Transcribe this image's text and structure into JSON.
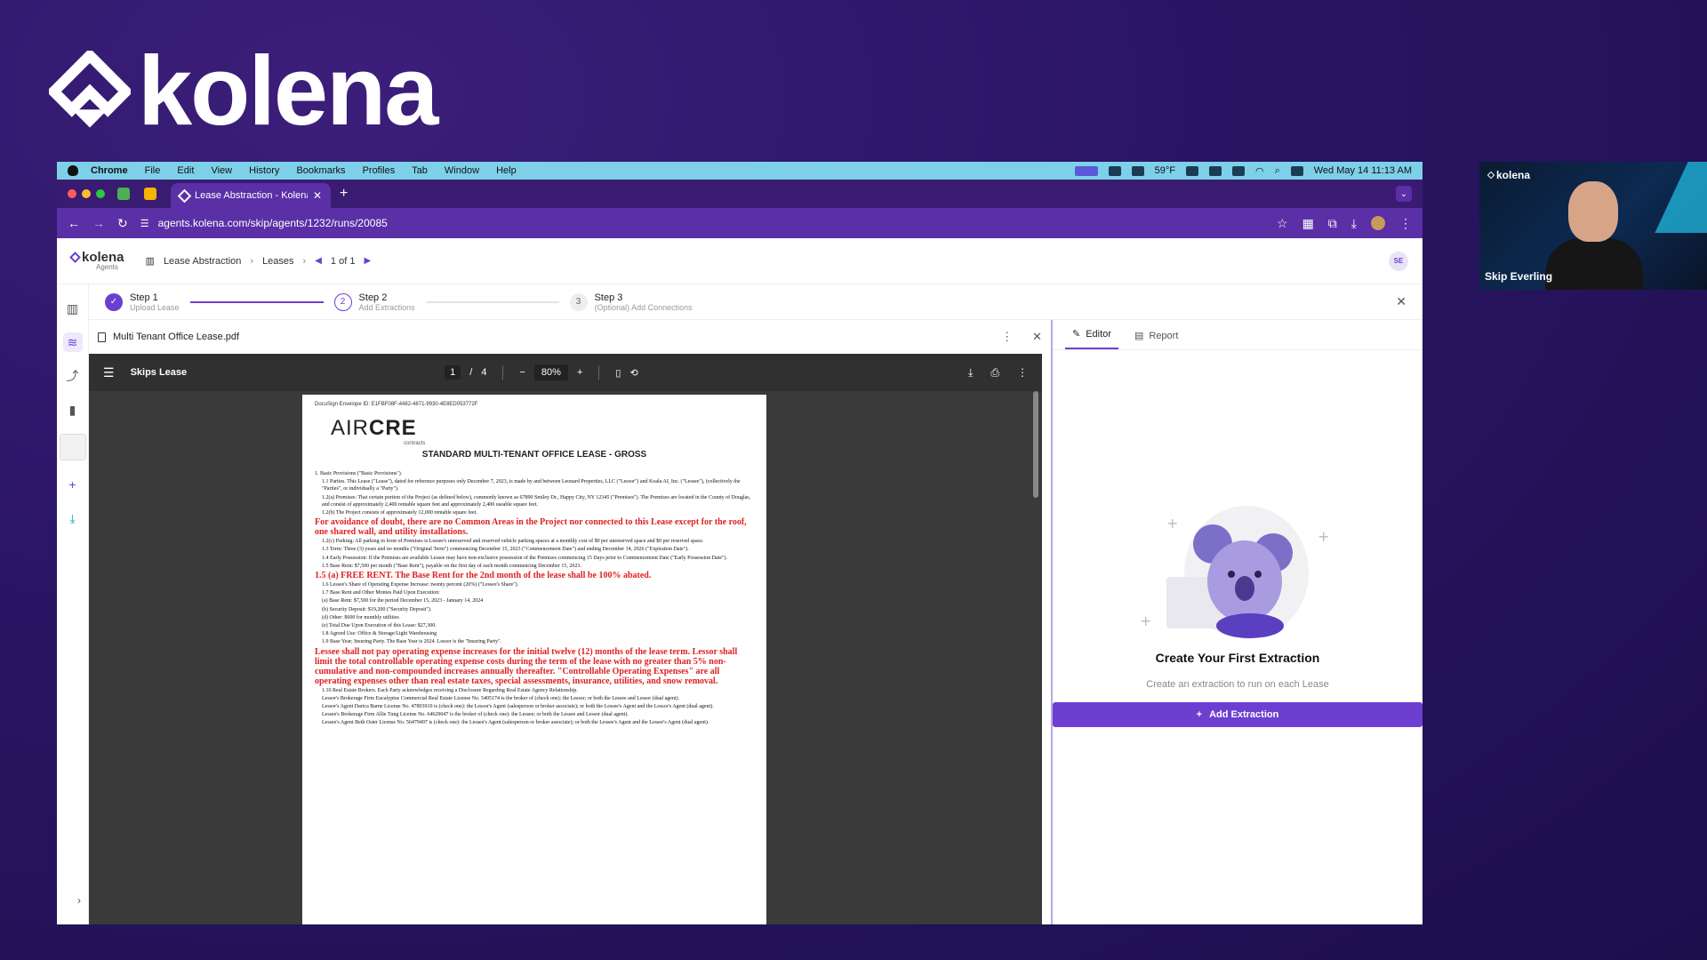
{
  "brand": {
    "wordmark": "kolena"
  },
  "mac_menu": {
    "items": [
      "Chrome",
      "File",
      "Edit",
      "View",
      "History",
      "Bookmarks",
      "Profiles",
      "Tab",
      "Window",
      "Help"
    ],
    "weather": "59°F",
    "datetime": "Wed May 14  11:13 AM"
  },
  "browser": {
    "tab_title": "Lease Abstraction - Kolena",
    "url": "agents.kolena.com/skip/agents/1232/runs/20085"
  },
  "app": {
    "logo_word": "kolena",
    "logo_sub": "Agents",
    "breadcrumb": [
      "Lease Abstraction",
      "Leases"
    ],
    "pager": "1 of 1",
    "user_initials": "SE"
  },
  "steps": [
    {
      "num": "",
      "title": "Step 1",
      "subtitle": "Upload Lease"
    },
    {
      "num": "2",
      "title": "Step 2",
      "subtitle": "Add Extractions"
    },
    {
      "num": "3",
      "title": "Step 3",
      "subtitle": "(Optional) Add Connections"
    }
  ],
  "file": {
    "name": "Multi Tenant Office Lease.pdf"
  },
  "viewer": {
    "doc_name": "Skips Lease",
    "page": "1",
    "page_total": "4",
    "zoom": "80%"
  },
  "pdf": {
    "envelope": "DocuSign Envelope ID: E1FBF08F-4482-4871-9930-4E8ED053772F",
    "brand_light": "AIR",
    "brand_bold": "CRE",
    "brand_sub": "contracts",
    "title": "STANDARD MULTI-TENANT OFFICE LEASE - GROSS",
    "lines": [
      "1.   Basic Provisions (\"Basic Provisions\").",
      "1.1  Parties. This Lease (\"Lease\"), dated for reference purposes only December 7, 2023, is made by and between Leonard Properties, LLC (\"Lessor\") and Koala AI, Inc. (\"Lessee\"), (collectively the \"Parties\", or individually a \"Party\").",
      "1.2(a) Premises: That certain portion of the Project (as defined below), commonly known as 67890 Smiley Dr., Happy City, NY 12345 (\"Premises\"). The Premises are located in the County of Douglas, and consist of approximately 2,400 rentable square feet and approximately 2,400 useable square feet.",
      "1.2(b) The Project consists of approximately 12,000 rentable square feet."
    ],
    "red1": "For avoidance of doubt, there are no Common Areas in the Project nor connected to this Lease except for the roof, one shared wall, and utility installations.",
    "lines2": [
      "1.2(c) Parking: All parking in front of Premises is Lessee's unreserved and reserved vehicle parking spaces at a monthly cost of $0 per unreserved space and $0 per reserved space.",
      "1.3  Term: Three (3) years and no months (\"Original Term\") commencing December 15, 2023 (\"Commencement Date\") and ending December 14, 2026 (\"Expiration Date\").",
      "1.4  Early Possession: If the Premises are available Lessee may have non-exclusive possession of the Premises commencing 15 Days prior to Commencement Date (\"Early Possession Date\").",
      "1.5  Base Rent: $7,500 per month (\"Base Rent\"), payable on the first day of each month commencing December 15, 2023."
    ],
    "red2": "1.5 (a) FREE RENT. The Base Rent for the 2nd month of the lease shall be 100% abated.",
    "lines3": [
      "1.6  Lessee's Share of Operating Expense Increase: twenty percent (20%) (\"Lessee's Share\").",
      "1.7  Base Rent and Other Monies Paid Upon Execution:",
      "(a) Base Rent: $7,500 for the period December 15, 2023 - January 14, 2024",
      "(b) Security Deposit: $19,200 (\"Security Deposit\").",
      "(d) Other: $600 for monthly utilities",
      "(e) Total Due Upon Execution of this Lease: $27,300.",
      "1.8  Agreed Use: Office & Storage/Light Warehousing",
      "1.9  Base Year; Insuring Party. The Base Year is 2024. Lessor is the \"Insuring Party\"."
    ],
    "red3": "Lessee shall not pay operating expense increases for the initial twelve (12) months of the lease term. Lessor shall limit the total controllable operating expense costs during the term of the lease with no greater than 5% non-cumulative and non-compounded increases annually thereafter. \"Controllable Operating Expenses\" are all operating expenses other than real estate taxes, special assessments, insurance, utilities, and snow removal.",
    "lines4": [
      "1.10 Real Estate Brokers. Each Party acknowledges receiving a Disclosure Regarding Real Estate Agency Relationship.",
      "Lessor's Brokerage Firm Eucalyptus Commercial Real Estate  License No. 5405174  is the broker of (check one): the Lessor; or both the Lessee and Lessor (dual agent).",
      "Lessor's Agent Darica Barne  License No. 47803910  is (check one): the Lessor's Agent (salesperson or broker associate); or both the Lessee's Agent and the Lessor's Agent (dual agent).",
      "Lessee's Brokerage Firm Allie Tung  License No. 64629047  is the broker of (check one): the Lessee; or both the Lessee and Lessor (dual agent).",
      "Lessee's Agent Beth Oster  License No. 56479497  is (check one): the Lessee's Agent (salesperson or broker associate); or both the Lessee's Agent and the Lessor's Agent (dual agent)."
    ]
  },
  "side": {
    "tab_editor": "Editor",
    "tab_report": "Report",
    "empty_title": "Create Your First Extraction",
    "empty_sub": "Create an extraction to run on each Lease",
    "add_button": "Add Extraction"
  },
  "webcam": {
    "logo": "kolena",
    "name": "Skip Everling"
  },
  "colors": {
    "accent": "#6d3fd1",
    "browser": "#5b2fa6",
    "red_text": "#e02020",
    "blue_fill": "#2a3fd0"
  }
}
